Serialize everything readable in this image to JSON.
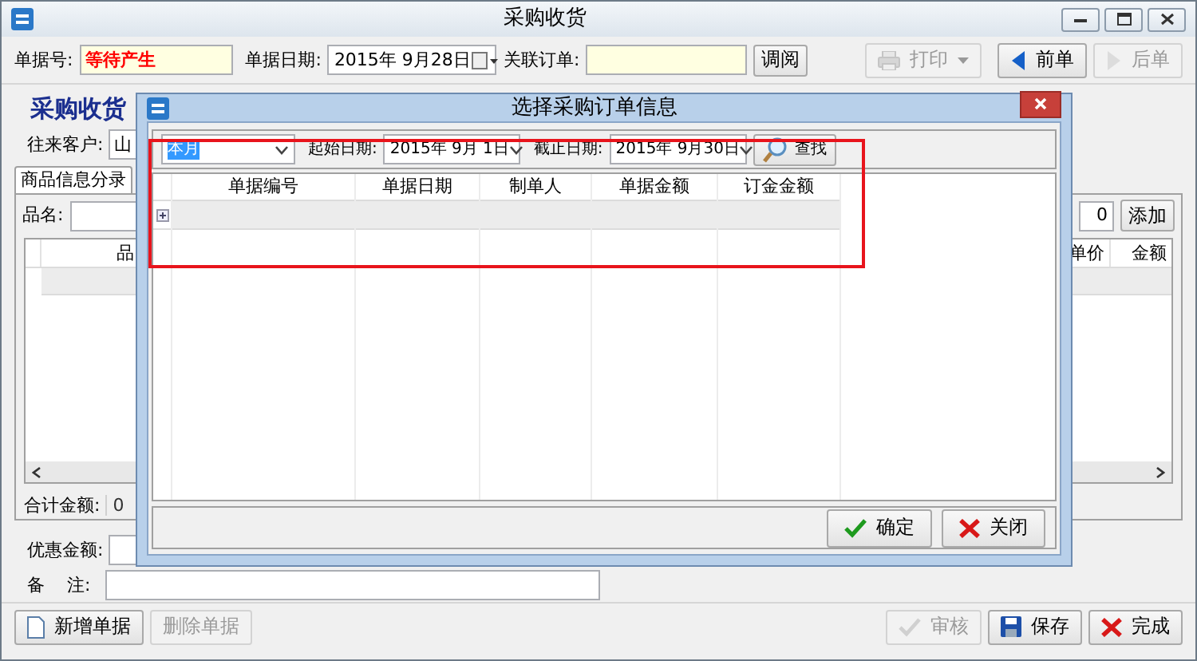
{
  "window": {
    "title": "采购收货"
  },
  "header": {
    "doc_no_label": "单据号:",
    "doc_no_value": "等待产生",
    "date_label": "单据日期:",
    "date_value": "2015年 9月28日",
    "order_label": "关联订单:",
    "lookup_button": "调阅"
  },
  "toolbar": [
    {
      "label": "打印",
      "kind": "print",
      "disabled": true
    },
    {
      "label": "前单",
      "kind": "prev",
      "disabled": false
    },
    {
      "label": "后单",
      "kind": "next",
      "disabled": true
    }
  ],
  "form": {
    "heading": "采购收货",
    "customer_label": "往来客户:",
    "customer_value": "山"
  },
  "tabs": [
    {
      "label": "商品信息分录",
      "selected": true
    }
  ],
  "item_row": {
    "name_label": "品名:",
    "qty_value": "0",
    "add_button": "添加"
  },
  "grid": {
    "columns": [
      "品",
      "单价",
      "金额"
    ]
  },
  "total": {
    "label": "合计金额:",
    "value": "0"
  },
  "discount_label": "优惠金额:",
  "remark_label": "备    注:",
  "bottom_left": [
    {
      "label": "新增单据",
      "kind": "new",
      "disabled": false
    },
    {
      "label": "删除单据",
      "kind": "delete",
      "disabled": true
    }
  ],
  "bottom_right": [
    {
      "label": "审核",
      "kind": "approve",
      "disabled": true
    },
    {
      "label": "保存",
      "kind": "save",
      "disabled": false
    },
    {
      "label": "完成",
      "kind": "finish",
      "disabled": false
    }
  ],
  "dialog": {
    "title": "选择采购订单信息",
    "period": {
      "value": "本月",
      "highlighted": true
    },
    "start_label": "起始日期:",
    "start_value": "2015年 9月 1日",
    "end_label": "截止日期:",
    "end_value": "2015年 9月30日",
    "search_button": "查找",
    "columns": [
      "单据编号",
      "单据日期",
      "制单人",
      "单据金额",
      "订金金额"
    ],
    "rows": [
      {
        "expanded": false
      }
    ],
    "highlight_filter_area": true,
    "buttons": [
      {
        "label": "确定",
        "kind": "ok"
      },
      {
        "label": "关闭",
        "kind": "close"
      }
    ]
  }
}
